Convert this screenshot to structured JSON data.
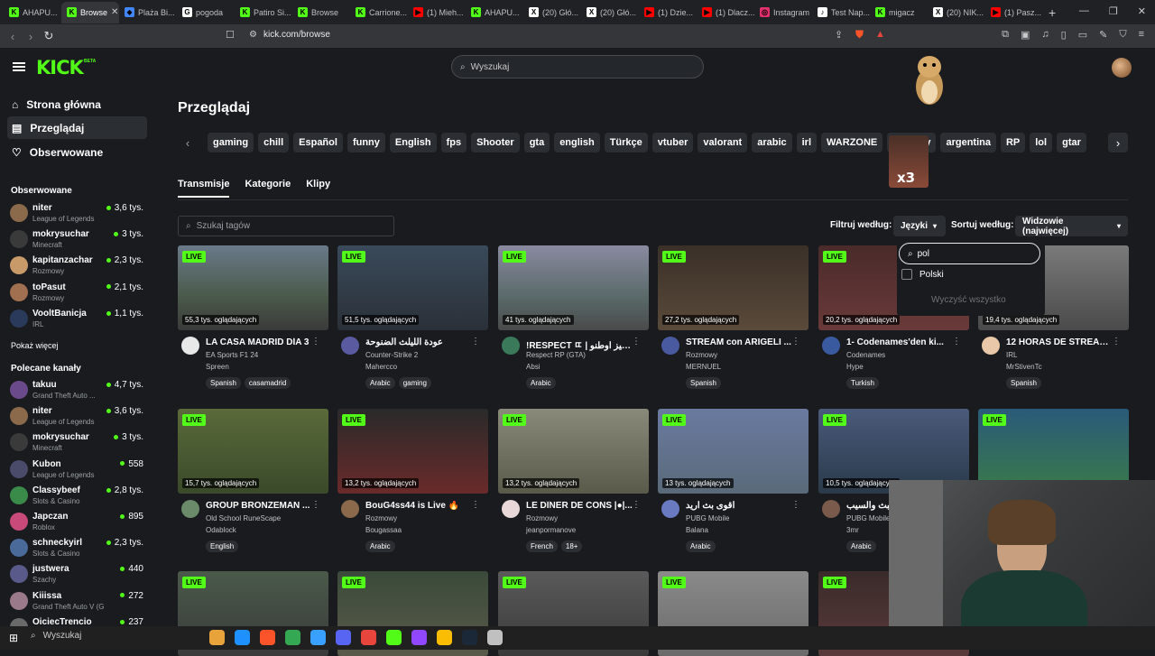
{
  "browser": {
    "tabs": [
      {
        "label": "AHAPU...",
        "color": "#53fc18",
        "fav": "K"
      },
      {
        "label": "Browse",
        "color": "#53fc18",
        "fav": "K",
        "active": true
      },
      {
        "label": "Plaża Bi...",
        "color": "#4285f4",
        "fav": "⬥"
      },
      {
        "label": "pogoda",
        "color": "#ffffff",
        "fav": "G"
      },
      {
        "label": "Patiro Si...",
        "color": "#53fc18",
        "fav": "K"
      },
      {
        "label": "Browse",
        "color": "#53fc18",
        "fav": "K"
      },
      {
        "label": "Carrione...",
        "color": "#53fc18",
        "fav": "K"
      },
      {
        "label": "(1) Mieh...",
        "color": "#ff0000",
        "fav": "▶"
      },
      {
        "label": "AHAPU...",
        "color": "#53fc18",
        "fav": "K"
      },
      {
        "label": "(20) Głó...",
        "color": "#ffffff",
        "fav": "X"
      },
      {
        "label": "(20) Głó...",
        "color": "#ffffff",
        "fav": "X"
      },
      {
        "label": "(1) Dzie...",
        "color": "#ff0000",
        "fav": "▶"
      },
      {
        "label": "(1) Dlacz...",
        "color": "#ff0000",
        "fav": "▶"
      },
      {
        "label": "Instagram",
        "color": "#e1306c",
        "fav": "◎"
      },
      {
        "label": "Test Nap...",
        "color": "#ffffff",
        "fav": "♪"
      },
      {
        "label": "migacz",
        "color": "#53fc18",
        "fav": "K"
      },
      {
        "label": "(20) NIK...",
        "color": "#ffffff",
        "fav": "X"
      },
      {
        "label": "(1) Pasz...",
        "color": "#ff0000",
        "fav": "▶"
      }
    ],
    "url": "kick.com/browse"
  },
  "header": {
    "logo": "KICK",
    "beta": "BETA",
    "search_placeholder": "Wyszukaj"
  },
  "sidebar": {
    "nav": [
      {
        "label": "Strona główna",
        "icon": "home-icon"
      },
      {
        "label": "Przeglądaj",
        "icon": "browse-icon"
      },
      {
        "label": "Obserwowane",
        "icon": "heart-icon"
      }
    ],
    "followed_title": "Obserwowane",
    "followed": [
      {
        "name": "niter",
        "category": "League of Legends",
        "viewers": "3,6 tys.",
        "color": "#8a6a4a"
      },
      {
        "name": "mokrysuchar",
        "category": "Minecraft",
        "viewers": "3 tys.",
        "color": "#3a3a3a"
      },
      {
        "name": "kapitanzachar",
        "category": "Rozmowy",
        "viewers": "2,3 tys.",
        "color": "#c89a6a"
      },
      {
        "name": "toPasut",
        "category": "Rozmowy",
        "viewers": "2,1 tys.",
        "color": "#a07050"
      },
      {
        "name": "VooltBanicja",
        "category": "IRL",
        "viewers": "1,1 tys.",
        "color": "#2a3a5a"
      }
    ],
    "show_more": "Pokaż więcej",
    "recommended_title": "Polecane kanały",
    "recommended": [
      {
        "name": "takuu",
        "category": "Grand Theft Auto ...",
        "viewers": "4,7 tys.",
        "color": "#6a4a8a"
      },
      {
        "name": "niter",
        "category": "League of Legends",
        "viewers": "3,6 tys.",
        "color": "#8a6a4a"
      },
      {
        "name": "mokrysuchar",
        "category": "Minecraft",
        "viewers": "3 tys.",
        "color": "#3a3a3a"
      },
      {
        "name": "Kubon",
        "category": "League of Legends",
        "viewers": "558",
        "color": "#4a4a6a"
      },
      {
        "name": "Classybeef",
        "category": "Slots & Casino",
        "viewers": "2,8 tys.",
        "color": "#3a8a4a"
      },
      {
        "name": "Japczan",
        "category": "Roblox",
        "viewers": "895",
        "color": "#c84a7a"
      },
      {
        "name": "schneckyirl",
        "category": "Slots & Casino",
        "viewers": "2,3 tys.",
        "color": "#4a6a9a"
      },
      {
        "name": "justwera",
        "category": "Szachy",
        "viewers": "440",
        "color": "#5a5a8a"
      },
      {
        "name": "Kiiissa",
        "category": "Grand Theft Auto V (G...",
        "viewers": "272",
        "color": "#9a7a8a"
      },
      {
        "name": "OiciecTrencio",
        "category": "",
        "viewers": "237",
        "color": "#6a6a6a"
      }
    ]
  },
  "main": {
    "title": "Przeglądaj",
    "tags": [
      "gaming",
      "chill",
      "Español",
      "funny",
      "English",
      "fps",
      "Shooter",
      "gta",
      "english",
      "Türkçe",
      "vtuber",
      "valorant",
      "arabic",
      "irl",
      "WARZONE",
      "roleplay",
      "argentina",
      "RP",
      "lol",
      "gtar"
    ],
    "tabs": [
      "Transmisje",
      "Kategorie",
      "Klipy"
    ],
    "tag_search_placeholder": "Szukaj tagów",
    "filter_label": "Filtruj według:",
    "filter_value": "Języki",
    "sort_label": "Sortuj według:",
    "sort_value": "Widzowie (najwięcej)",
    "live_label": "LIVE"
  },
  "dropdown": {
    "value": "pol",
    "option": "Polski",
    "clear": "Wyczyść wszystko"
  },
  "streams": [
    {
      "viewers": "55,3 tys. oglądających",
      "title": "LA CASA MADRID DÍA 3",
      "category": "EA Sports F1 24",
      "user": "Spreen",
      "tags": [
        "Spanish",
        "casamadrid"
      ],
      "bg": "linear-gradient(#6a7a8a,#4a5a4a 60%,#3a3a3a)",
      "av": "#e8e8e8"
    },
    {
      "viewers": "51,5 tys. oglądających",
      "title": "عودة الليلث الضنوحة",
      "category": "Counter-Strike 2",
      "user": "Mahercco",
      "tags": [
        "Arabic",
        "gaming"
      ],
      "bg": "linear-gradient(#3a4a5a,#2a3038)",
      "av": "#5a5aa0"
    },
    {
      "viewers": "41 tys. oglądających",
      "title": "!RESPECT ㄸ | قوميز اوطنو",
      "category": "Respect RP (GTA)",
      "user": "Absi",
      "tags": [
        "Arabic"
      ],
      "bg": "linear-gradient(#8a8aa0,#5a6a6a 60%,#4a4a4a)",
      "av": "#3a7a5a"
    },
    {
      "viewers": "27,2 tys. oglądających",
      "title": "STREAM con ARIGELI ...",
      "category": "Rozmowy",
      "user": "MERNUEL",
      "tags": [
        "Spanish"
      ],
      "bg": "linear-gradient(#3a3028,#5a4a3a)",
      "av": "#4a5aa0"
    },
    {
      "viewers": "20,2 tys. oglądających",
      "title": "1- Codenames'den ki...",
      "category": "Codenames",
      "user": "Hype",
      "tags": [
        "Turkish"
      ],
      "bg": "linear-gradient(#4a2a2a,#6a3a3a)",
      "av": "#3a5aa0"
    },
    {
      "viewers": "19,4 tys. oglądających",
      "title": "12 HORAS DE STREAM...",
      "category": "IRL",
      "user": "MrStivenTc",
      "tags": [
        "Spanish"
      ],
      "bg": "linear-gradient(#7a7a7a,#4a4a4a)",
      "av": "#e8c8a8"
    },
    {
      "viewers": "15,7 tys. oglądających",
      "title": "GROUP BRONZEMAN ...",
      "category": "Old School RuneScape",
      "user": "Odablock",
      "tags": [
        "English"
      ],
      "bg": "linear-gradient(#5a6a3a,#3a4a2a)",
      "av": "#6a8a6a"
    },
    {
      "viewers": "13,2 tys. oglądających",
      "title": "BouG4ss44 is Live 🔥",
      "category": "Rozmowy",
      "user": "Bougassaa",
      "tags": [
        "Arabic"
      ],
      "bg": "linear-gradient(#2a2a2a,#6a2a2a)",
      "av": "#8a6a4a"
    },
    {
      "viewers": "13,2 tys. oglądających",
      "title": "LE DÎNER DE CONS |●|...",
      "category": "Rozmowy",
      "user": "jeanpormanove",
      "tags": [
        "French",
        "18+"
      ],
      "bg": "linear-gradient(#8a8a7a,#5a5a4a)",
      "av": "#e8d8d8"
    },
    {
      "viewers": "13 tys. oglądających",
      "title": "اقوى بث اريد",
      "category": "PUBG Mobile",
      "user": "Balana",
      "tags": [
        "Arabic"
      ],
      "bg": "linear-gradient(#6a7aa0,#5a6a7a)",
      "av": "#6a7ac0"
    },
    {
      "viewers": "10,5 tys. oglądających",
      "title": "اللقوى البث والسيب",
      "category": "PUBG Mobile",
      "user": "3mr",
      "tags": [
        "Arabic"
      ],
      "bg": "linear-gradient(#4a5a7a,#2a3a4a)",
      "av": "#7a5a4a"
    },
    {
      "viewers": "",
      "title": "",
      "category": "",
      "user": "",
      "tags": [],
      "bg": "linear-gradient(#2a5a7a,#3a7a4a)",
      "av": "#333"
    },
    {
      "viewers": "",
      "title": "",
      "category": "",
      "user": "",
      "tags": [],
      "bg": "linear-gradient(#4a5a4a,#3a3a3a)",
      "av": "#333"
    },
    {
      "viewers": "",
      "title": "",
      "category": "",
      "user": "",
      "tags": [],
      "bg": "linear-gradient(#3a4a3a,#5a5a4a)",
      "av": "#333"
    },
    {
      "viewers": "",
      "title": "",
      "category": "",
      "user": "",
      "tags": [],
      "bg": "linear-gradient(#5a5a5a,#3a3a3a)",
      "av": "#333"
    },
    {
      "viewers": "",
      "title": "",
      "category": "",
      "user": "",
      "tags": [],
      "bg": "linear-gradient(#8a8a8a,#6a6a6a)",
      "av": "#333"
    },
    {
      "viewers": "",
      "title": "",
      "category": "",
      "user": "",
      "tags": [],
      "bg": "linear-gradient(#3a2a2a,#5a3a3a)",
      "av": "#333"
    }
  ],
  "overlay": {
    "sticker_text": "x3"
  },
  "taskbar": {
    "search": "Wyszukaj",
    "apps": [
      "#e8a33a",
      "#1e90ff",
      "#fb542b",
      "#34a853",
      "#3aa0ff",
      "#5865f2",
      "#e8453c",
      "#53fc18",
      "#9146ff",
      "#fbbc04",
      "#1b2838",
      "#c0c0c0"
    ]
  }
}
